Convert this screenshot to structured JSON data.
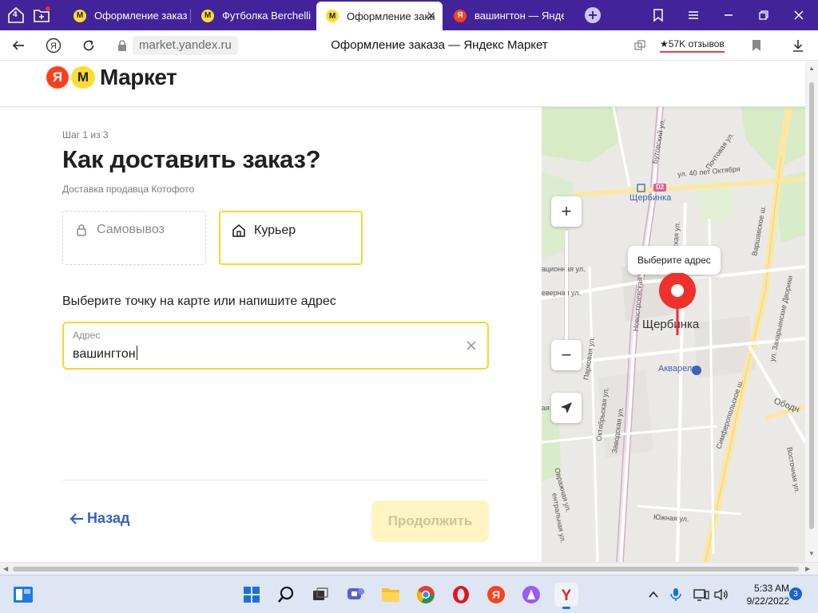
{
  "browser": {
    "tab_count_badge": "4",
    "tabs": [
      {
        "label": "Оформление заказ",
        "active": false
      },
      {
        "label": "Футболка Berchelli",
        "active": false
      },
      {
        "label": "Оформление зака",
        "active": true
      },
      {
        "label": "вашингтон — Яндекс",
        "active": false
      }
    ],
    "url": "market.yandex.ru",
    "page_title": "Оформление заказа — Яндекс Маркет",
    "reviews_badge": "★57K отзывов"
  },
  "header": {
    "logo_ya": "Я",
    "logo_m": "М",
    "logo_text": "Маркет"
  },
  "checkout": {
    "step_label": "Шаг 1 из 3",
    "title": "Как доставить заказ?",
    "seller_note": "Доставка продавца Котофото",
    "options": {
      "pickup_label": "Самовывоз",
      "courier_label": "Курьер",
      "selected": "courier"
    },
    "address_prompt": "Выберите точку на карте или напишите адрес",
    "address_field": {
      "label": "Адрес",
      "value": "вашингтон"
    },
    "back_label": "Назад",
    "continue_label": "Продолжить"
  },
  "map": {
    "tooltip": "Выберите адрес",
    "city_label": "Щербинка",
    "station_label": "Щербинка",
    "station_badge": "D2",
    "poi_label": "Акварель",
    "zoom_in": "+",
    "zoom_out": "−",
    "streets": [
      "Почтовая ул.",
      "ул. 40 лет Октября",
      "Варшавское ш.",
      "Бутовский ул.",
      "Новостроевская ул.",
      "Симферопольское ш.",
      "Парковая ул.",
      "Октябрьская ул.",
      "Заводская ул.",
      "Южная ул.",
      "Овражная ул.",
      "Восточная ул.",
      "ул. Захарьинские Дворики",
      "Ободн",
      "ационная ул.",
      "еверная ул.",
      "ская ул.",
      "ентральная ул.",
      "ая ул."
    ]
  },
  "taskbar": {
    "time": "5:33 AM",
    "date": "9/22/2022",
    "notification_count": "3"
  },
  "colors": {
    "tabstrip": "#43239a",
    "accent_yellow": "#fed42b",
    "link_blue": "#3361c6",
    "pin_red": "#f0302b",
    "brand_red": "#fc3f1d"
  }
}
